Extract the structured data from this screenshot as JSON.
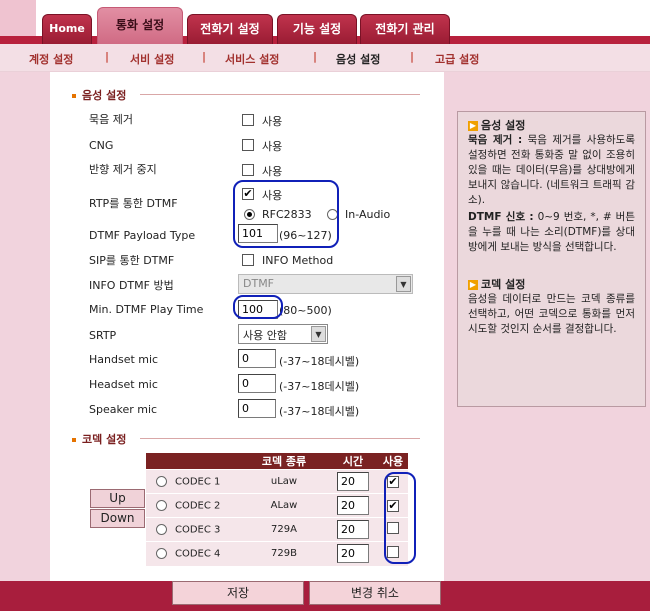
{
  "tabs": [
    {
      "label": "Home"
    },
    {
      "label": "통화 설정"
    },
    {
      "label": "전화기 설정"
    },
    {
      "label": "기능 설정"
    },
    {
      "label": "전화기 관리"
    }
  ],
  "subnav": [
    {
      "label": "계정 설정"
    },
    {
      "label": "서비 설정"
    },
    {
      "label": "서비스 설정"
    },
    {
      "label": "음성 설정"
    },
    {
      "label": "고급 설정"
    }
  ],
  "voice_section": {
    "title": "음성 설정",
    "mute_label": "묵음 제거",
    "mute_option": "사용",
    "cng_label": "CNG",
    "cng_option": "사용",
    "echo_label": "반향 제거 중지",
    "echo_option": "사용",
    "rtp_label": "RTP를 통한 DTMF",
    "rtp_option": "사용",
    "rtp_radio_1": "RFC2833",
    "rtp_radio_2": "In-Audio",
    "payload_label": "DTMF Payload Type",
    "payload_value": "101",
    "payload_range": "(96~127)",
    "sip_label": "SIP를 통한 DTMF",
    "sip_option": "INFO Method",
    "info_label": "INFO DTMF 방법",
    "info_value": "DTMF",
    "min_play_label": "Min. DTMF Play Time",
    "min_play_value": "100",
    "min_play_range": "(80~500)",
    "srtp_label": "SRTP",
    "srtp_value": "사용 안함",
    "handset_label": "Handset mic",
    "handset_value": "0",
    "handset_range": "(-37~18데시벨)",
    "headset_label": "Headset mic",
    "headset_value": "0",
    "headset_range": "(-37~18데시벨)",
    "speaker_label": "Speaker mic",
    "speaker_value": "0",
    "speaker_range": "(-37~18데시벨)"
  },
  "codec_section": {
    "title": "코덱 설정",
    "headers": {
      "type": "코덱 종류",
      "time": "시간",
      "use": "사용"
    },
    "rows": [
      {
        "name": "CODEC 1",
        "type": "uLaw",
        "time": "20",
        "use": true
      },
      {
        "name": "CODEC 2",
        "type": "ALaw",
        "time": "20",
        "use": true
      },
      {
        "name": "CODEC 3",
        "type": "729A",
        "time": "20",
        "use": false
      },
      {
        "name": "CODEC 4",
        "type": "729B",
        "time": "20",
        "use": false
      }
    ],
    "up_label": "Up",
    "down_label": "Down"
  },
  "buttons": {
    "save": "저장",
    "cancel": "변경 취소"
  },
  "help": {
    "voice_title": "음성 설정",
    "mute_term": "묵음 제거 :",
    "mute_text": " 묵음 제거를 사용하도록 설정하면 전화 통화중 말 없이 조용히 있을 때는 데이터(무음)를 상대방에게 보내지 않습니다. (네트워크 트래픽 감소).",
    "dtmf_term": "DTMF 신호 :",
    "dtmf_text": " 0~9 번호, *, # 버튼을 누를 때 나는 소리(DTMF)를 상대방에게 보내는 방식을 선택합니다.",
    "codec_title": "코덱 설정",
    "codec_text": "음성을 데이터로 만드는 코덱 종류를 선택하고, 어떤 코덱으로 통화를 먼저 시도할 것인지 순서를 결정합니다."
  },
  "colors": {
    "accent": "#b8213d",
    "panel": "#f1d3dd",
    "highlight_ring": "#1020b8"
  }
}
